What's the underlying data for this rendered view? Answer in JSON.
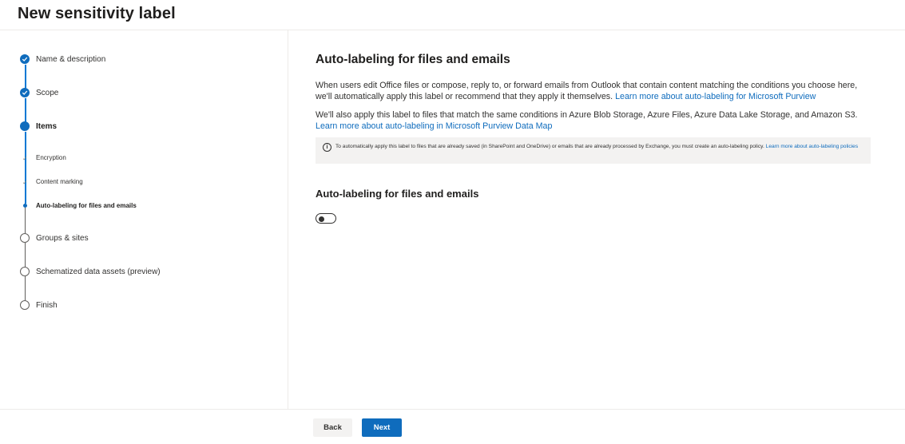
{
  "page": {
    "title": "New sensitivity label"
  },
  "steps": [
    {
      "label": "Name & description",
      "state": "done"
    },
    {
      "label": "Scope",
      "state": "done"
    },
    {
      "label": "Items",
      "state": "current"
    },
    {
      "label": "Encryption",
      "state": "sub-done"
    },
    {
      "label": "Content marking",
      "state": "sub-done"
    },
    {
      "label": "Auto-labeling for files and emails",
      "state": "sub-current"
    },
    {
      "label": "Groups & sites",
      "state": "todo"
    },
    {
      "label": "Schematized data assets (preview)",
      "state": "todo"
    },
    {
      "label": "Finish",
      "state": "todo"
    }
  ],
  "main": {
    "heading": "Auto-labeling for files and emails",
    "para1_text": "When users edit Office files or compose, reply to, or forward emails from Outlook that contain content matching the conditions you choose here, we'll automatically apply this label or recommend that they apply it themselves. ",
    "para1_link": "Learn more about auto-labeling for Microsoft Purview",
    "para2_text": "We'll also apply this label to files that match the same conditions in Azure Blob Storage, Azure Files, Azure Data Lake Storage, and Amazon S3. ",
    "para2_link": "Learn more about auto-labeling in Microsoft Purview Data Map",
    "info_text": "To automatically apply this label to files that are already saved (in SharePoint and OneDrive) or emails that are already processed by Exchange, you must create an auto-labeling policy. ",
    "info_link": "Learn more about auto-labeling policies",
    "toggle_heading": "Auto-labeling for files and emails",
    "toggle_on": false
  },
  "footer": {
    "back_label": "Back",
    "next_label": "Next"
  },
  "colors": {
    "accent": "#0f6cbd",
    "info_bg": "#f3f2f1"
  },
  "icons": {
    "done": "checkmark-circle-icon",
    "info": "info-icon"
  }
}
